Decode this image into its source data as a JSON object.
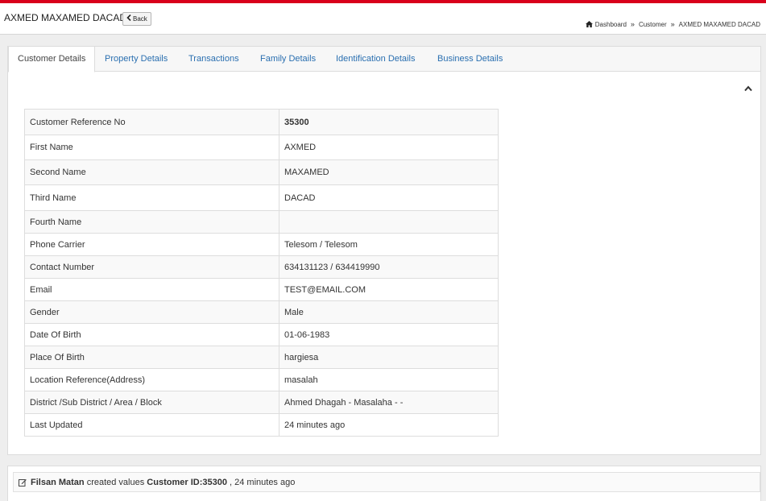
{
  "header": {
    "title": "AXMED MAXAMED DACAD",
    "back_label": "Back",
    "breadcrumb": [
      "Dashboard",
      "Customer",
      "AXMED MAXAMED DACAD"
    ]
  },
  "tabs": [
    {
      "label": "Customer Details",
      "active": true
    },
    {
      "label": "Property Details",
      "active": false
    },
    {
      "label": "Transactions",
      "active": false
    },
    {
      "label": "Family Details",
      "active": false
    },
    {
      "label": "Identification Details",
      "active": false
    },
    {
      "label": "Business Details",
      "active": false
    }
  ],
  "details": [
    {
      "label": "Customer Reference No",
      "value": "35300"
    },
    {
      "label": "First Name",
      "value": "AXMED"
    },
    {
      "label": "Second Name",
      "value": "MAXAMED"
    },
    {
      "label": "Third Name",
      "value": "DACAD"
    },
    {
      "label": "Fourth Name",
      "value": ""
    },
    {
      "label": "Phone Carrier",
      "value": "Telesom / Telesom"
    },
    {
      "label": "Contact Number",
      "value": "634131123 / 634419990"
    },
    {
      "label": "Email",
      "value": "TEST@EMAIL.COM"
    },
    {
      "label": "Gender",
      "value": "Male"
    },
    {
      "label": "Date Of Birth",
      "value": "01-06-1983"
    },
    {
      "label": "Place Of Birth",
      "value": "hargiesa"
    },
    {
      "label": "Location Reference(Address)",
      "value": "masalah"
    },
    {
      "label": "District /Sub District / Area / Block",
      "value": "Ahmed Dhagah - Masalaha - -"
    },
    {
      "label": "Last Updated",
      "value": "24 minutes ago"
    }
  ],
  "activity": {
    "user": "Filsan Matan",
    "action": "created values",
    "subject": "Customer ID:35300",
    "time": ", 24 minutes ago"
  },
  "icons": {
    "home": "home-icon",
    "back": "chevron-left-icon",
    "collapse": "chevron-up-icon",
    "edit": "edit-icon"
  },
  "colors": {
    "top_bar": "#d9001b",
    "tab_link": "#2a6fb0"
  }
}
